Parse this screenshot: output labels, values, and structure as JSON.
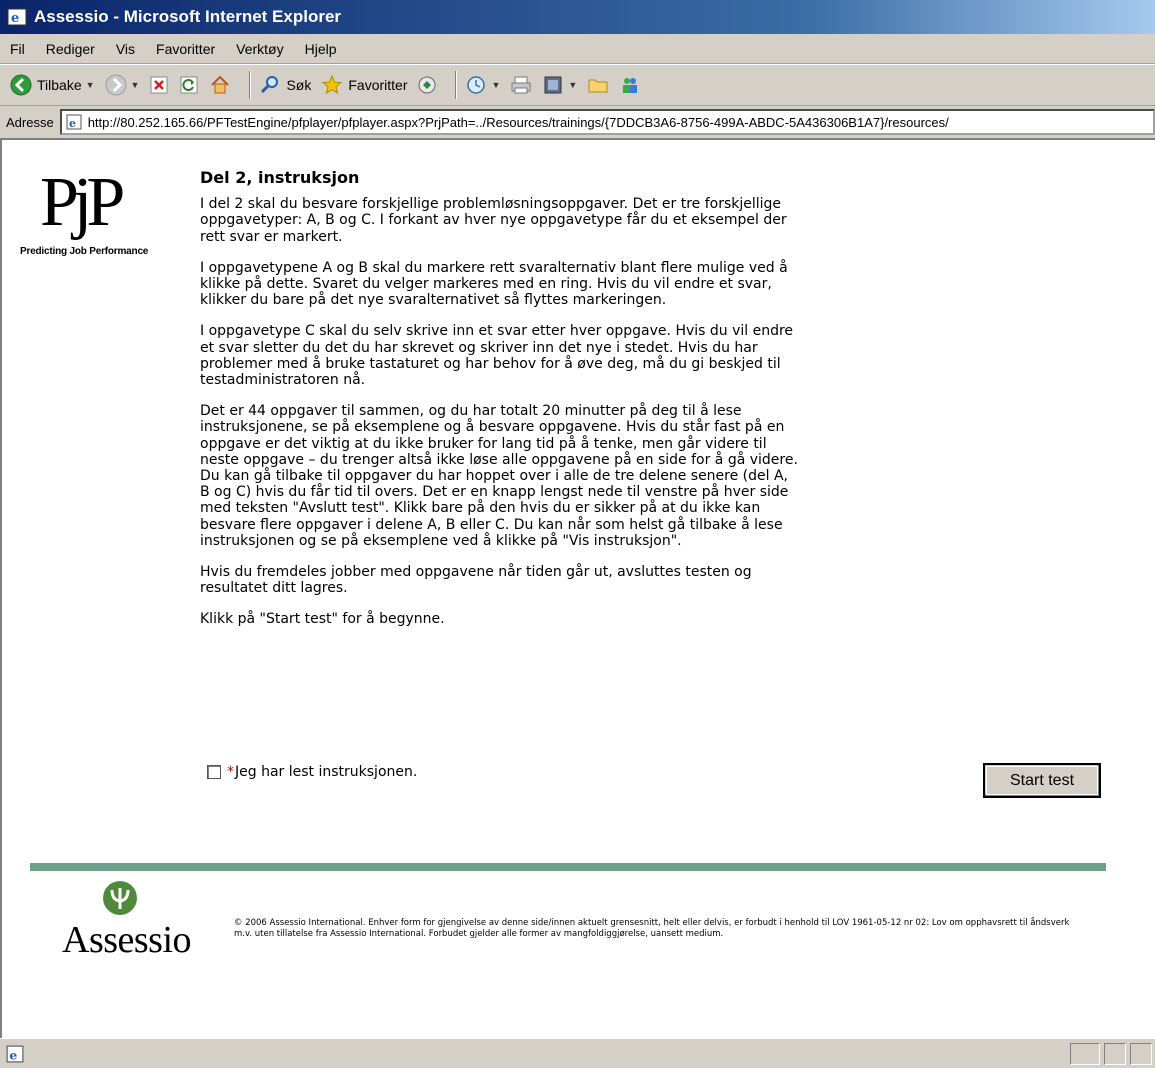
{
  "window": {
    "title": "Assessio - Microsoft Internet Explorer"
  },
  "menubar": {
    "items": [
      "Fil",
      "Rediger",
      "Vis",
      "Favoritter",
      "Verktøy",
      "Hjelp"
    ]
  },
  "toolbar": {
    "back_label": "Tilbake",
    "search_label": "Søk",
    "favorites_label": "Favoritter"
  },
  "address": {
    "label": "Adresse",
    "url": "http://80.252.165.66/PFTestEngine/pfplayer/pfplayer.aspx?PrjPath=../Resources/trainings/{7DDCB3A6-8756-499A-ABDC-5A436306B1A7}/resources/"
  },
  "logo": {
    "word": "PjP",
    "tagline": "Predicting Job Performance"
  },
  "content": {
    "heading": "Del 2, instruksjon",
    "paragraphs": [
      "I del 2 skal du besvare forskjellige problemløsningsoppgaver. Det er tre forskjellige oppgavetyper: A, B og C. I forkant av hver nye oppgavetype får du et eksempel der rett svar er markert.",
      "I oppgavetypene A og B skal du markere rett svaralternativ blant flere mulige ved å klikke på dette. Svaret du velger markeres med en ring. Hvis du vil endre et svar, klikker du bare på det nye svaralternativet så flyttes markeringen.",
      "I oppgavetype C skal du selv skrive inn et svar etter hver oppgave. Hvis du vil endre et svar sletter du det du har skrevet og skriver inn det nye i stedet. Hvis du har problemer med å bruke tastaturet og har behov for å øve deg, må du gi beskjed til testadministratoren nå.",
      "Det er 44 oppgaver til sammen, og du har totalt 20 minutter på deg til å lese instruksjonene, se på eksemplene og å besvare oppgavene. Hvis du står fast på en oppgave er det viktig at du ikke bruker for lang tid på å tenke, men går videre til neste oppgave – du trenger altså ikke løse alle oppgavene på en side for å gå videre. Du kan gå tilbake til oppgaver du har hoppet over i alle de tre delene senere (del A, B og C) hvis du får tid til overs. Det er en knapp lengst nede til venstre på hver side med teksten \"Avslutt test\". Klikk bare på den hvis du er sikker på at du ikke kan besvare flere oppgaver i delene A, B eller C. Du kan når som helst gå tilbake å lese instruksjonen og se på eksemplene ved å klikke på \"Vis instruksjon\".",
      "Hvis du fremdeles jobber med oppgavene når tiden går ut, avsluttes testen og resultatet ditt lagres.",
      "Klikk på \"Start test\" for å begynne."
    ],
    "confirm_required": "*",
    "confirm_label": "Jeg har lest instruksjonen.",
    "confirm_checked": false,
    "start_button": "Start test"
  },
  "footer": {
    "logo_word": "Assessio",
    "copyright": "© 2006 Assessio International. Enhver form for gjengivelse av denne side/innen aktuelt grensesnitt, helt eller delvis, er forbudt i henhold til LOV 1961-05-12 nr 02: Lov om opphavsrett til åndsverk m.v. uten tillatelse fra Assessio International. Forbudet gjelder alle former av mangfoldiggjørelse, uansett medium."
  },
  "colors": {
    "title_bar": "#0a246a",
    "divider": "#6fa28a",
    "assessio_green": "#4f8a3a",
    "required_star": "#d00000"
  }
}
